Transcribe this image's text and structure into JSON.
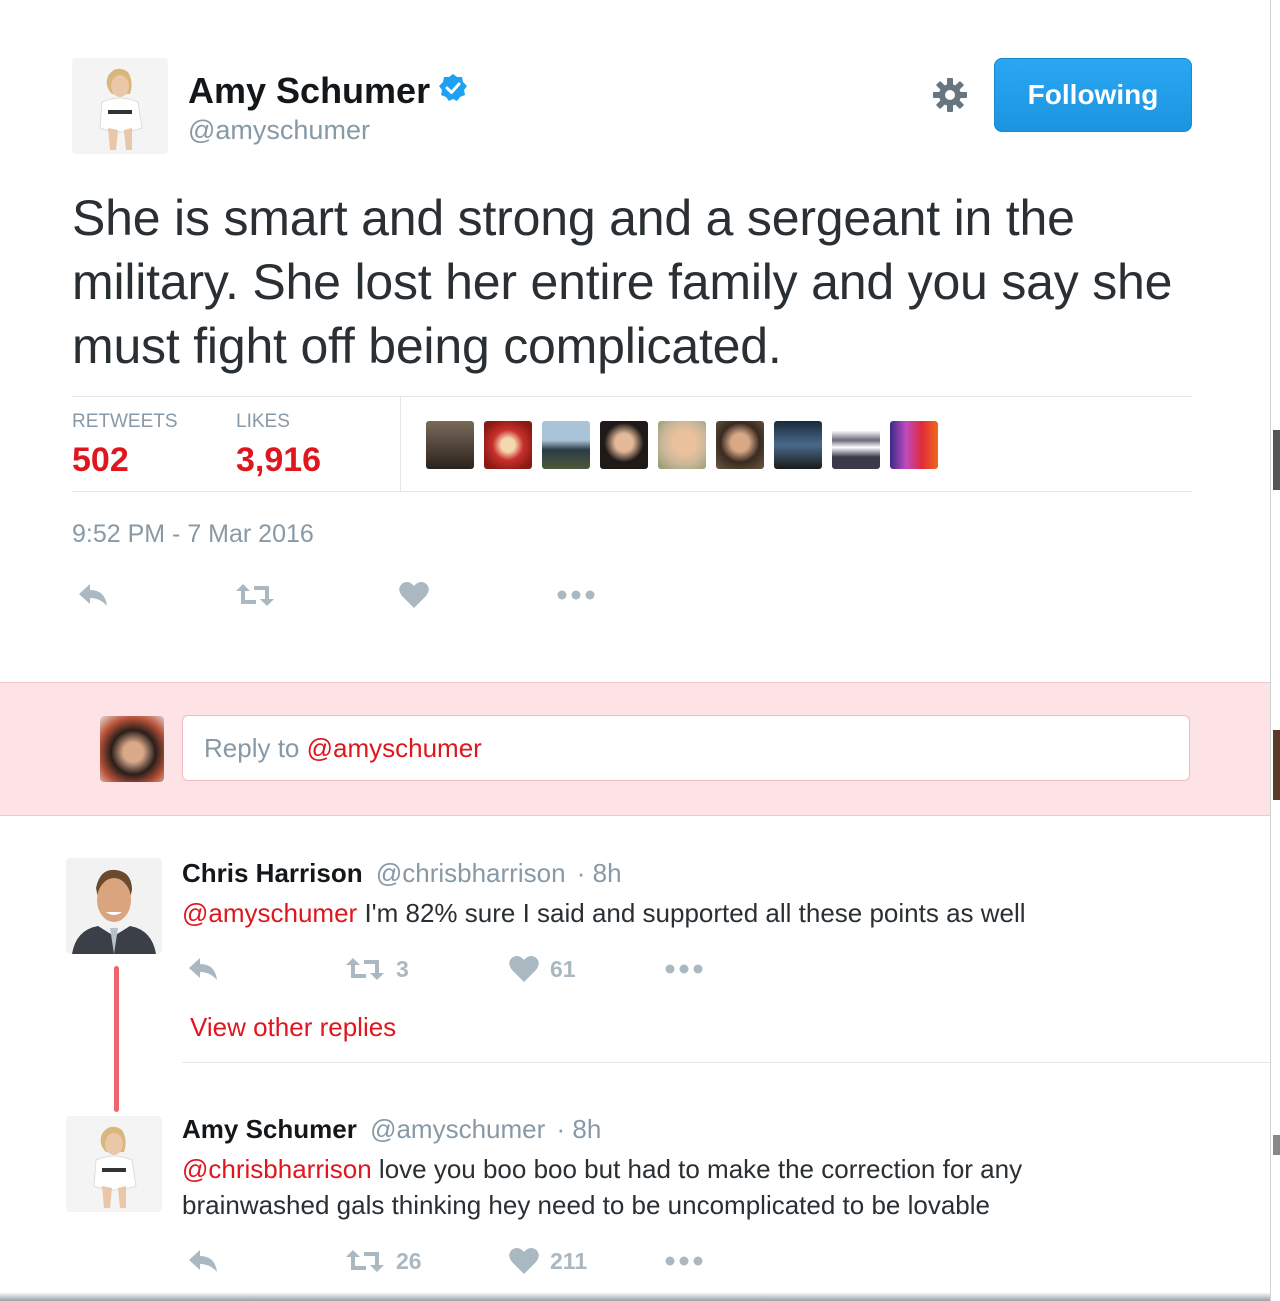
{
  "tweet": {
    "author_name": "Amy Schumer",
    "author_handle": "@amyschumer",
    "follow_label": "Following",
    "text": "She is smart and strong and a sergeant in the military. She lost her entire family and you say she must fight off being complicated.",
    "stats": {
      "retweets_label": "RETWEETS",
      "retweets_value": "502",
      "likes_label": "LIKES",
      "likes_value": "3,916"
    },
    "timestamp": "9:52 PM - 7 Mar 2016",
    "icons": [
      "reply-icon",
      "retweet-icon",
      "heart-icon",
      "more-icon",
      "gear-icon",
      "verified-badge-icon"
    ]
  },
  "reply_box": {
    "prefix": "Reply to ",
    "mention": "@amyschumer"
  },
  "replies": [
    {
      "author_name": "Chris Harrison",
      "author_handle": "@chrisbharrison",
      "time": "· 8h",
      "mention": "@amyschumer",
      "text": " I'm 82% sure I said and supported all these points as well",
      "retweets": "3",
      "likes": "61"
    },
    {
      "author_name": "Amy Schumer",
      "author_handle": "@amyschumer",
      "time": "· 8h",
      "mention": "@chrisbharrison",
      "text": " love you boo boo but had to make the correction for any brainwashed gals thinking hey need to be uncomplicated to be lovable",
      "retweets": "26",
      "likes": "211"
    }
  ],
  "view_other_replies": "View other replies",
  "colors": {
    "accent_red": "#e0161f",
    "follow_blue": "#1da1f2",
    "muted_gray": "#8899a6",
    "reply_bg": "#fde3e5"
  }
}
